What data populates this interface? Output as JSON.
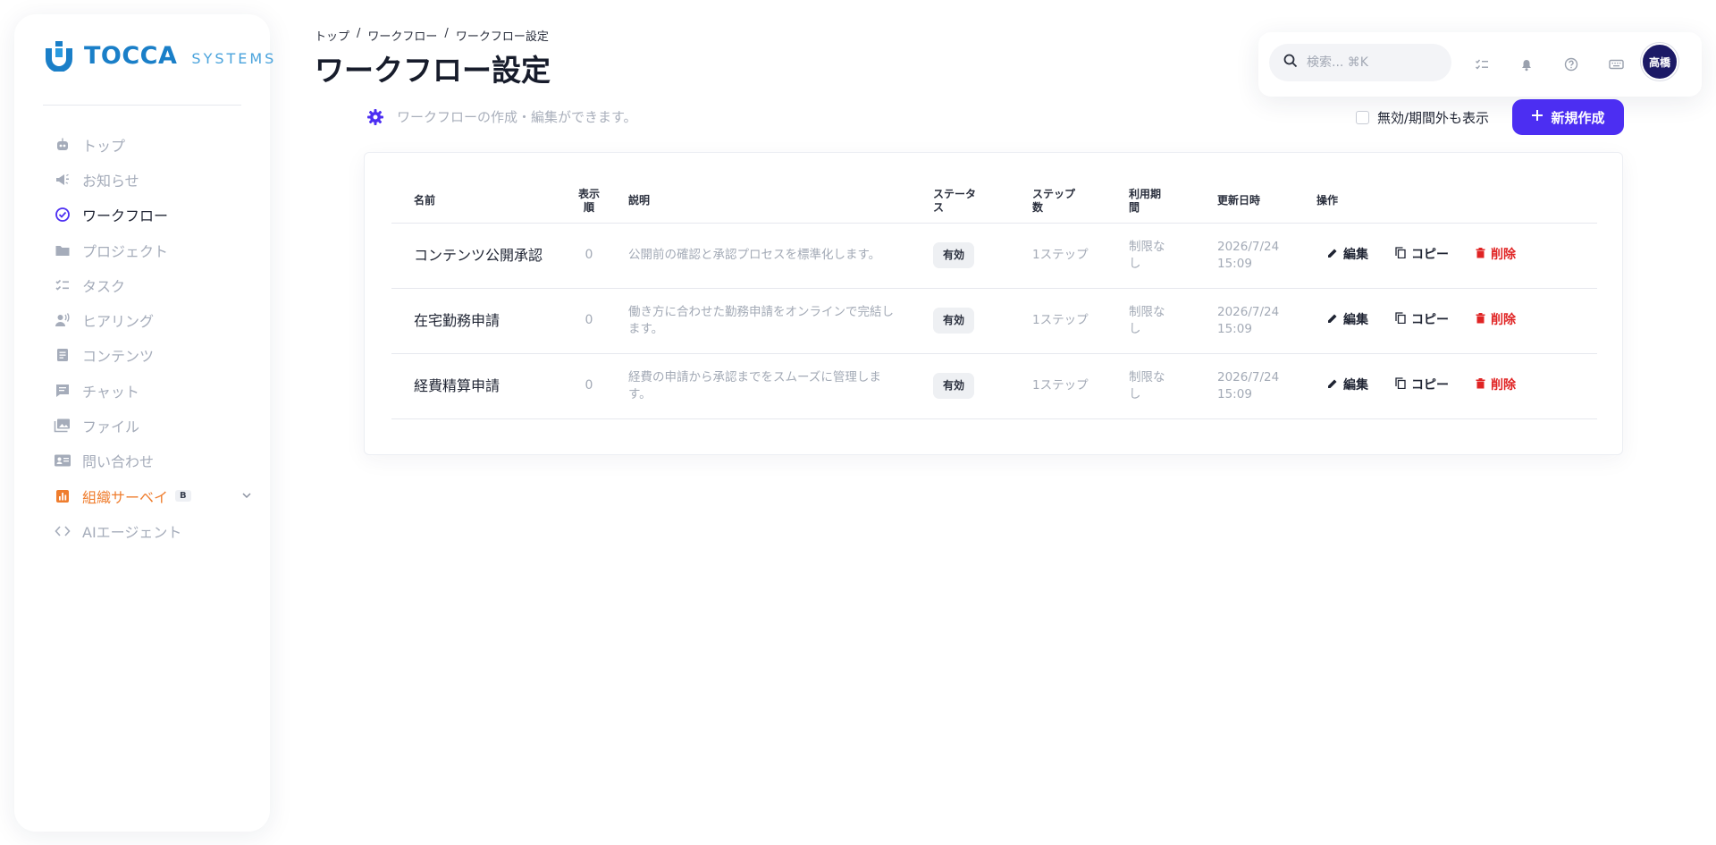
{
  "brand": {
    "name": "TOCCA",
    "suffix": "SYSTEMS"
  },
  "sidebar": {
    "items": [
      {
        "label": "トップ",
        "icon": "robot-icon"
      },
      {
        "label": "お知らせ",
        "icon": "megaphone-icon"
      },
      {
        "label": "ワークフロー",
        "icon": "check-circle-icon",
        "active": true
      },
      {
        "label": "プロジェクト",
        "icon": "folder-icon"
      },
      {
        "label": "タスク",
        "icon": "checklist-icon"
      },
      {
        "label": "ヒアリング",
        "icon": "speaking-person-icon"
      },
      {
        "label": "コンテンツ",
        "icon": "document-icon"
      },
      {
        "label": "チャット",
        "icon": "chat-icon"
      },
      {
        "label": "ファイル",
        "icon": "photo-library-icon"
      },
      {
        "label": "問い合わせ",
        "icon": "contact-card-icon"
      },
      {
        "label": "組織サーベイ",
        "icon": "bar-chart-icon",
        "badge": "B"
      },
      {
        "label": "AIエージェント",
        "icon": "code-icon"
      }
    ]
  },
  "breadcrumb": [
    "トップ",
    "ワークフロー",
    "ワークフロー設定"
  ],
  "breadcrumb_sep": "/",
  "page": {
    "title": "ワークフロー設定",
    "subtitle": "ワークフローの作成・編集ができます。",
    "show_inactive_label": "無効/期間外も表示",
    "new_button_label": "新規作成"
  },
  "topbar": {
    "search_placeholder": "検索... ⌘K",
    "avatar_label": "高橋"
  },
  "table": {
    "headers": {
      "name": "名前",
      "order": "表示順",
      "desc": "説明",
      "status": "ステータス",
      "steps": "ステップ数",
      "period": "利用期間",
      "updated": "更新日時",
      "actions": "操作"
    },
    "action_labels": {
      "edit": "編集",
      "copy": "コピー",
      "delete": "削除"
    },
    "rows": [
      {
        "name": "コンテンツ公開承認",
        "order": "0",
        "desc": "公開前の確認と承認プロセスを標準化します。",
        "status": "有効",
        "steps": "1ステップ",
        "period": "制限なし",
        "updated": "2026/7/24 15:09"
      },
      {
        "name": "在宅勤務申請",
        "order": "0",
        "desc": "働き方に合わせた勤務申請をオンラインで完結します。",
        "status": "有効",
        "steps": "1ステップ",
        "period": "制限なし",
        "updated": "2026/7/24 15:09"
      },
      {
        "name": "経費精算申請",
        "order": "0",
        "desc": "経費の申請から承認までをスムーズに管理します。",
        "status": "有効",
        "steps": "1ステップ",
        "period": "制限なし",
        "updated": "2026/7/24 15:09"
      }
    ]
  },
  "colors": {
    "accent": "#4c2ef2",
    "brand": "#1a7fc8",
    "survey": "#ef7d2e",
    "danger": "#e02424"
  }
}
